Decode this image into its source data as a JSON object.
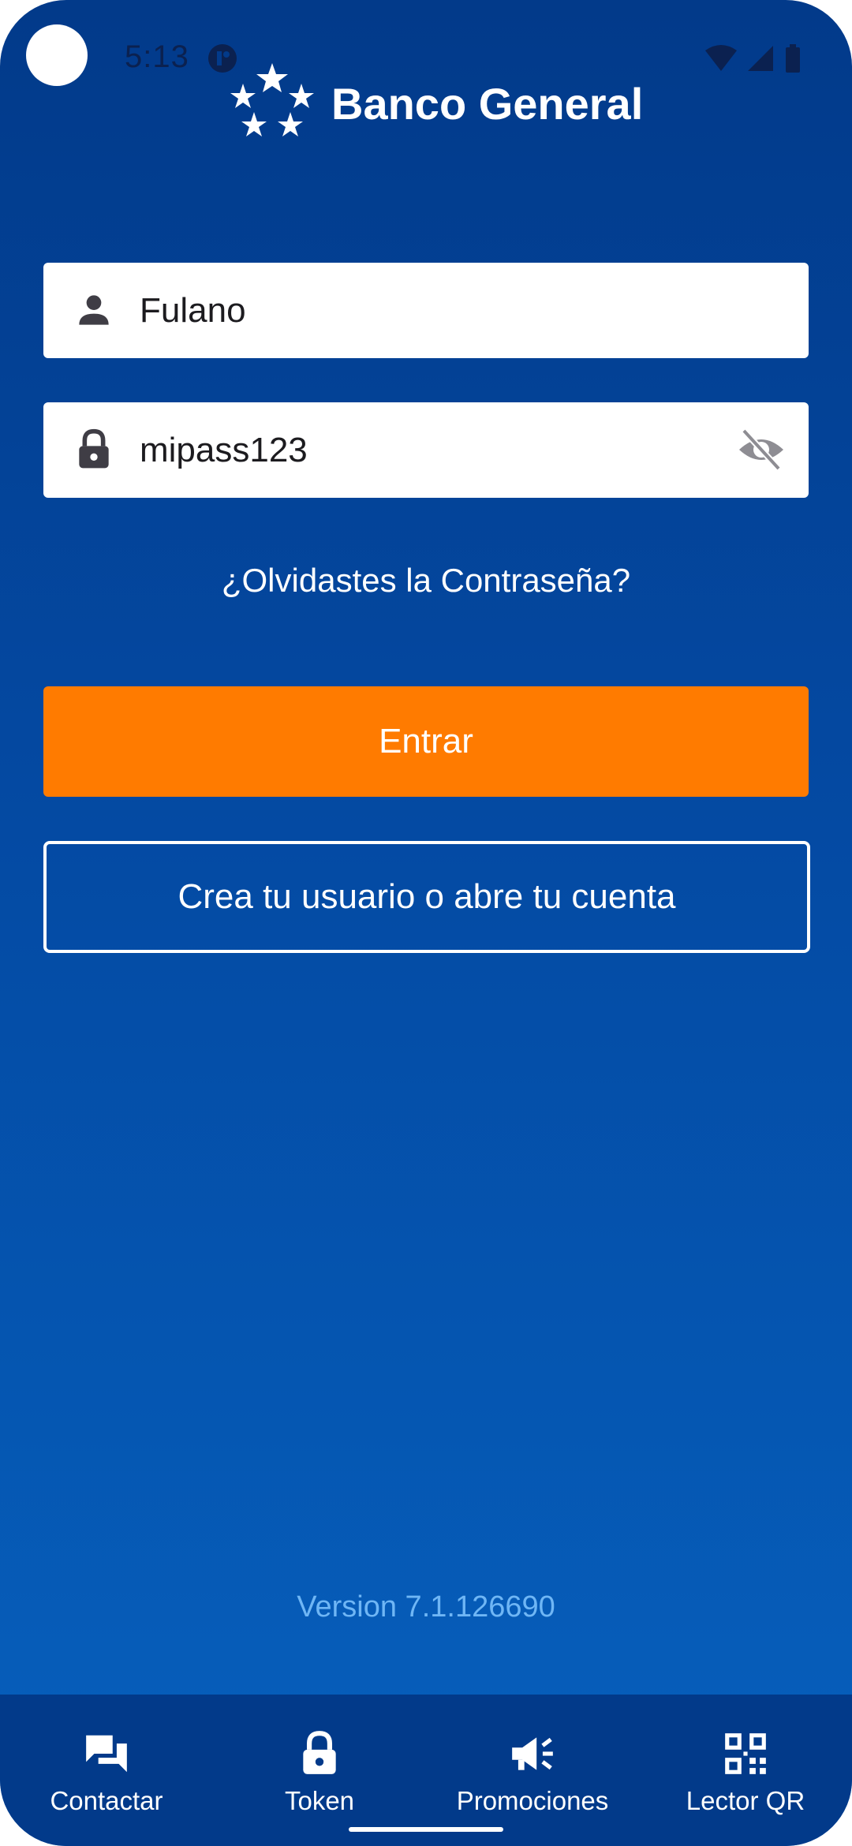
{
  "status_bar": {
    "time": "5:13"
  },
  "header": {
    "logo_text": "Banco General"
  },
  "login_form": {
    "username_value": "Fulano",
    "password_value": "mipass123",
    "forgot_password_label": "¿Olvidastes la Contraseña?",
    "submit_label": "Entrar",
    "create_account_label": "Crea tu usuario o abre tu cuenta"
  },
  "footer": {
    "version": "Version 7.1.126690"
  },
  "bottom_nav": {
    "items": [
      {
        "label": "Contactar",
        "icon": "chat-icon"
      },
      {
        "label": "Token",
        "icon": "lock-icon"
      },
      {
        "label": "Promociones",
        "icon": "megaphone-icon"
      },
      {
        "label": "Lector QR",
        "icon": "qr-code-icon"
      }
    ]
  },
  "colors": {
    "background_top": "#023a8a",
    "background_bottom": "#0660bd",
    "primary_button": "#ff7b00",
    "version_text": "#6fb6f5"
  }
}
